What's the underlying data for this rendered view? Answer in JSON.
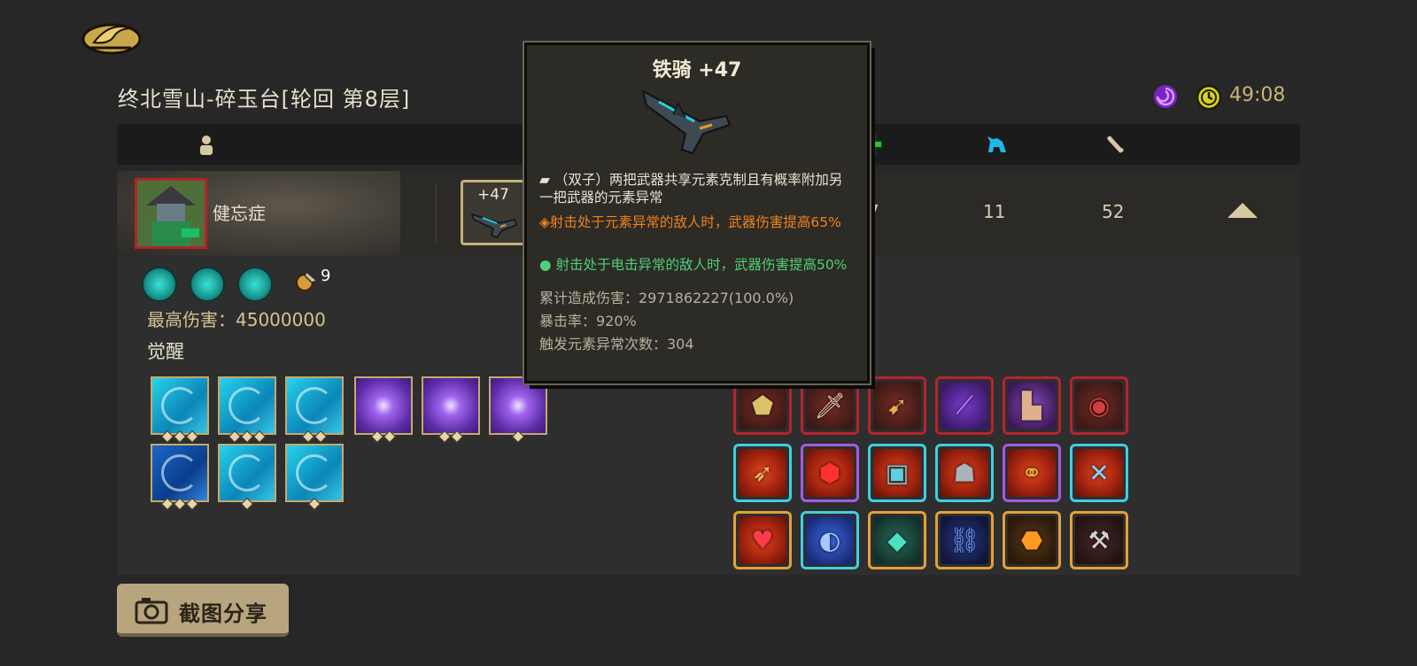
{
  "top": {
    "level_title": "终北雪山-碎玉台[轮回 第8层]",
    "timer": "49:08"
  },
  "player": {
    "name": "健忘症",
    "weapon_level": "+47",
    "stats": [
      "7",
      "11",
      "52"
    ]
  },
  "details": {
    "coin_count": "9",
    "max_damage": "最高伤害：45000000",
    "partial_percent": "%",
    "awaken_label": "觉醒"
  },
  "tooltip": {
    "title": "铁骑 +47",
    "desc": "（双子）两把武器共享元素克制且有概率附加另一把武器的元素异常",
    "bullet_orange": "射击处于元素异常的敌人时，武器伤害提高65%",
    "bullet_green": "射击处于电击异常的敌人时，武器伤害提高50%",
    "stat_damage": "累计造成伤害：2971862227(100.0%)",
    "stat_crit": "暴击率：920%",
    "stat_trigger": "触发元素异常次数：304"
  },
  "share": {
    "label": "截图分享"
  },
  "colors": {
    "background": "#272727",
    "accent_gold": "#c7b07c",
    "orange_text": "#f0821e",
    "green_text": "#4fd07a",
    "rarity_red": "#b8232c",
    "rarity_cyan": "#3ed0e1",
    "rarity_violet": "#a45be0",
    "rarity_orange": "#e2a13a"
  }
}
